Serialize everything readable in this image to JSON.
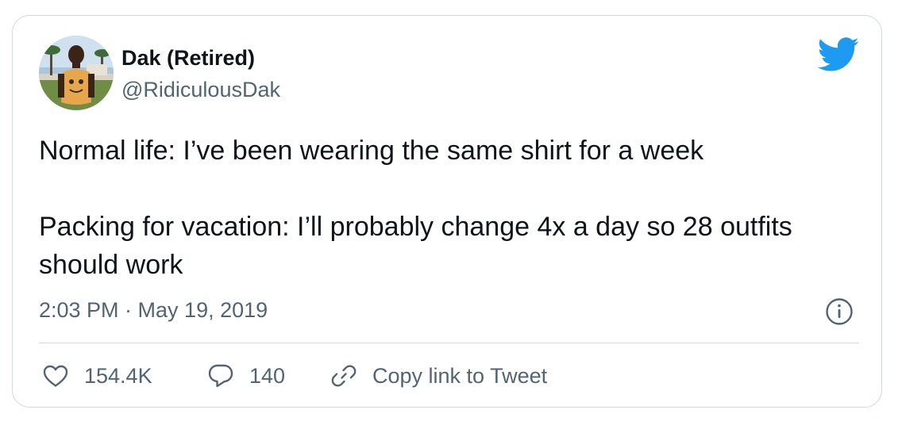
{
  "author": {
    "name": "Dak (Retired)",
    "handle": "@RidiculousDak"
  },
  "tweet": {
    "lines": [
      "Normal life: I’ve been wearing the same shirt for a week",
      "Packing for vacation: I’ll probably change 4x a day so 28 outfits should work"
    ],
    "timestamp": "2:03 PM · May 19, 2019"
  },
  "actions": {
    "likes": "154.4K",
    "replies": "140",
    "copy_link_label": "Copy link to Tweet"
  },
  "icons": {
    "brand": "twitter-bird-icon",
    "info": "info-icon",
    "like": "heart-icon",
    "reply": "reply-bubble-icon",
    "copy": "link-icon"
  },
  "colors": {
    "brand": "#1d9bf0",
    "text": "#0f1419",
    "secondary": "#536471",
    "border": "#cfd9de"
  }
}
